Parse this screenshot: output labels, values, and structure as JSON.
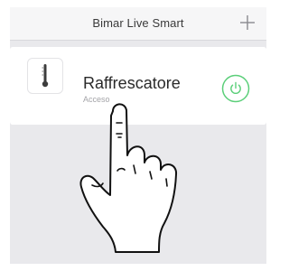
{
  "header": {
    "title": "Bimar Live Smart",
    "add_icon": "plus-icon"
  },
  "device": {
    "name": "Raffrescatore",
    "status": "Acceso",
    "icon": "thermometer-icon",
    "power_icon": "power-icon",
    "power_color": "#5ccf7a"
  },
  "overlay": {
    "icon": "pointing-hand-icon"
  }
}
